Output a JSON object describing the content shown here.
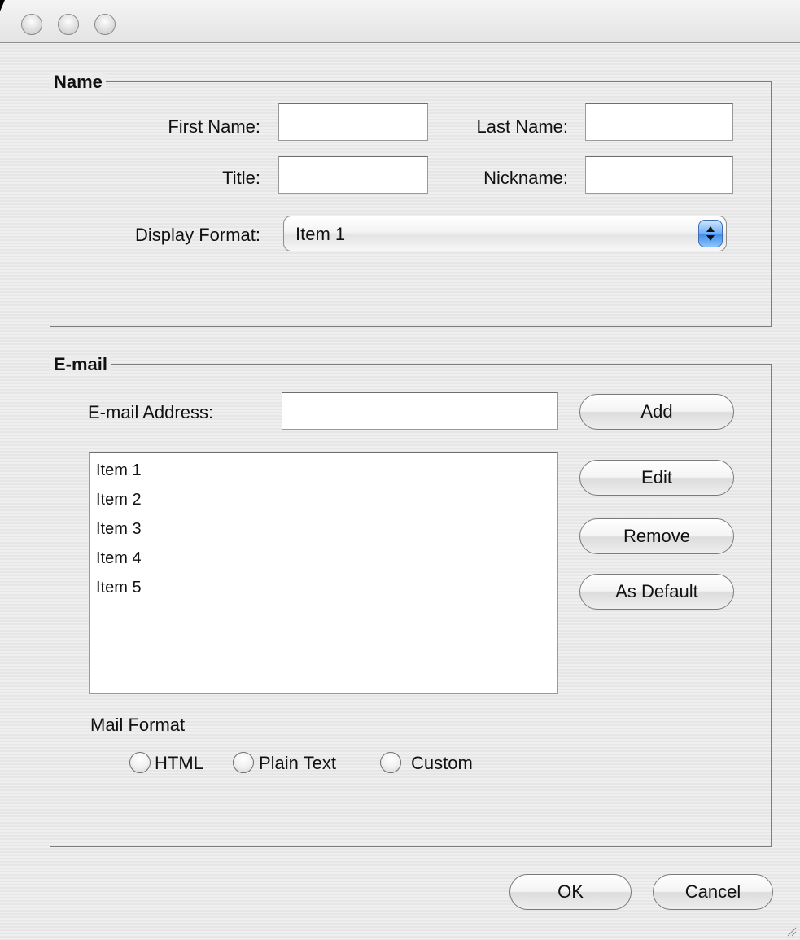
{
  "window": {
    "title": "",
    "buttons": [
      "close",
      "minimize",
      "zoom"
    ]
  },
  "name_group": {
    "legend": "Name",
    "first_name_label": "First Name:",
    "first_name_value": "",
    "last_name_label": "Last Name:",
    "last_name_value": "",
    "title_label": "Title:",
    "title_value": "",
    "nickname_label": "Nickname:",
    "nickname_value": "",
    "display_format_label": "Display Format:",
    "display_format_selected": "Item 1"
  },
  "email_group": {
    "legend": "E-mail",
    "address_label": "E-mail Address:",
    "address_value": "",
    "buttons": {
      "add": "Add",
      "edit": "Edit",
      "remove": "Remove",
      "as_default": "As Default"
    },
    "list_items": [
      "Item 1",
      "Item 2",
      "Item 3",
      "Item 4",
      "Item 5"
    ],
    "mail_format_label": "Mail Format",
    "mail_format_options": [
      "HTML",
      "Plain Text",
      "Custom"
    ]
  },
  "footer": {
    "ok": "OK",
    "cancel": "Cancel"
  },
  "colors": {
    "window_background": "#ececec",
    "group_border": "#7d7d7d",
    "popup_arrow_blue": "#3d8ae6"
  }
}
